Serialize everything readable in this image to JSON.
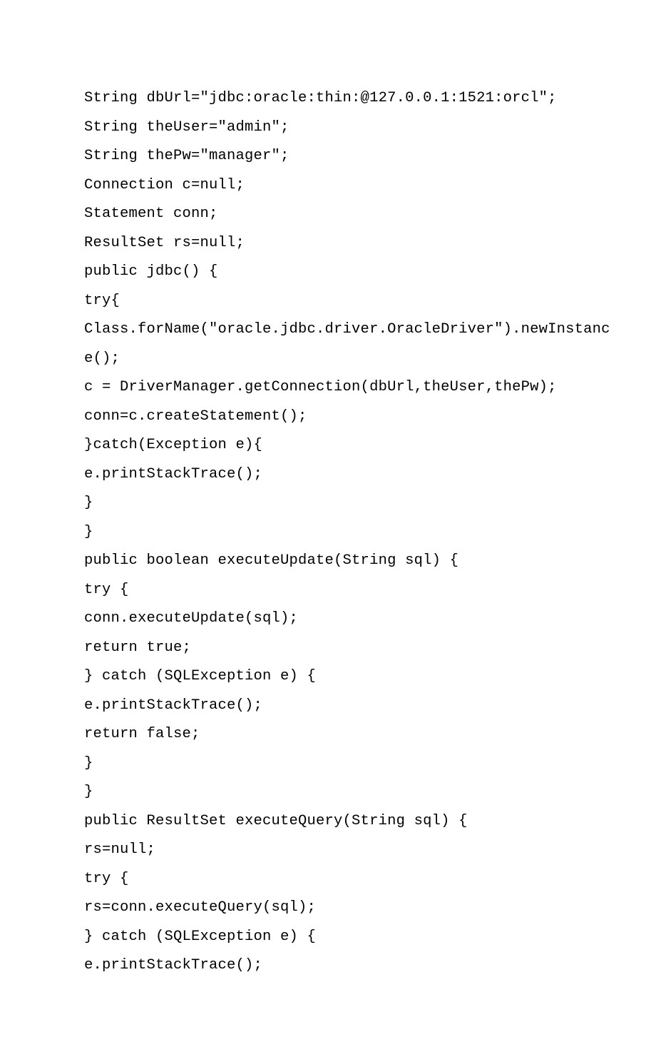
{
  "code": {
    "lines": [
      "String dbUrl=\"jdbc:oracle:thin:@127.0.0.1:1521:orcl\";",
      "String theUser=\"admin\";",
      "String thePw=\"manager\";",
      "Connection c=null;",
      "Statement conn;",
      "ResultSet rs=null;",
      "public jdbc() {",
      "try{",
      "Class.forName(\"oracle.jdbc.driver.OracleDriver\").newInstanc",
      "e();",
      "c = DriverManager.getConnection(dbUrl,theUser,thePw);",
      "conn=c.createStatement();",
      "}catch(Exception e){",
      "e.printStackTrace();",
      "}",
      "}",
      "public boolean executeUpdate(String sql) {",
      "try {",
      "conn.executeUpdate(sql);",
      "return true;",
      "} catch (SQLException e) {",
      "e.printStackTrace();",
      "return false;",
      "}",
      "}",
      "public ResultSet executeQuery(String sql) {",
      "rs=null;",
      "try {",
      "rs=conn.executeQuery(sql);",
      "} catch (SQLException e) {",
      "e.printStackTrace();"
    ]
  }
}
